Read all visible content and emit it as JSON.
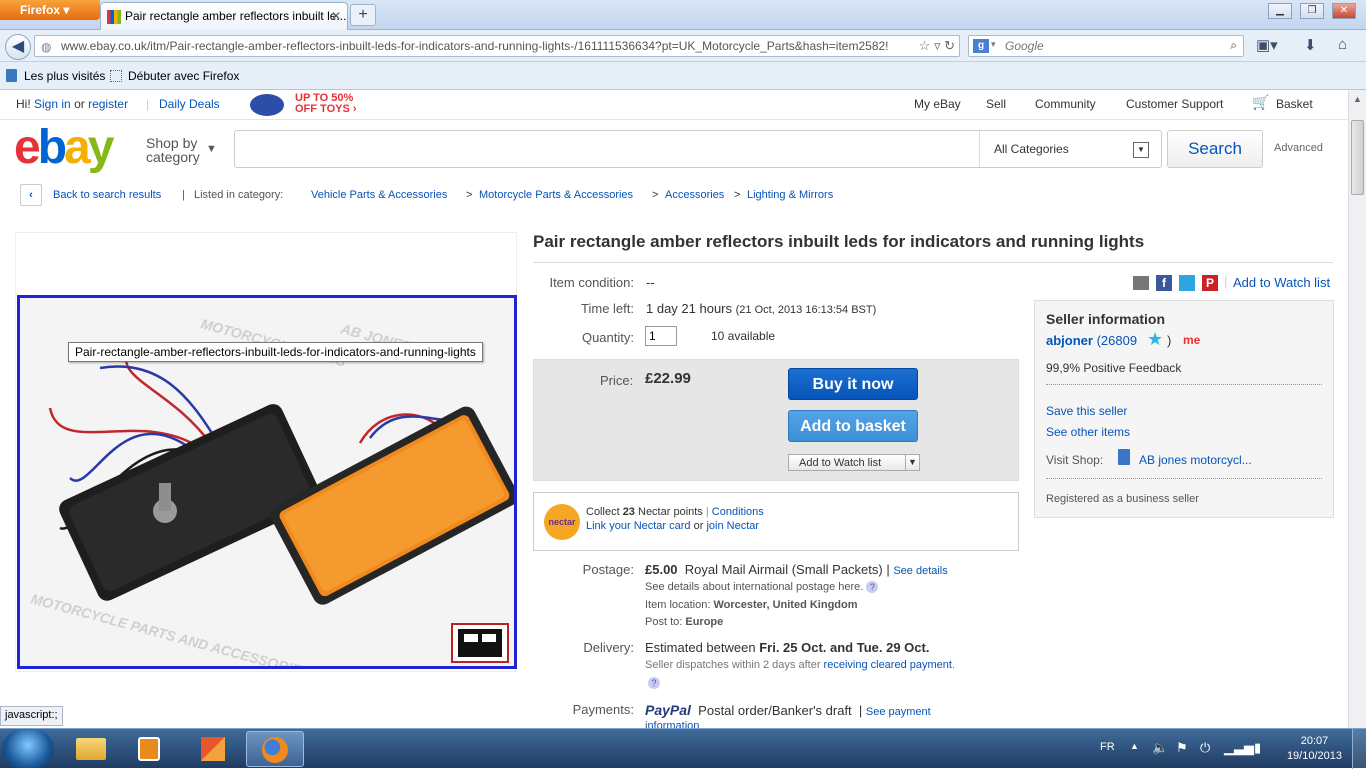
{
  "browser": {
    "menu_label": "Firefox",
    "tab_title": "Pair rectangle amber reflectors inbuilt le...",
    "new_tab": "+",
    "url": "www.ebay.co.uk/itm/Pair-rectangle-amber-reflectors-inbuilt-leds-for-indicators-and-running-lights-/161111536634?pt=UK_Motorcycle_Parts&hash=item2582!",
    "search_engine": "g",
    "search_placeholder": "Google",
    "bookmarks": [
      "Les plus visités",
      "Débuter avec Firefox"
    ],
    "status_text": "javascript:;"
  },
  "ebay": {
    "greeting_prefix": "Hi!",
    "sign_in": "Sign in",
    "or": "or",
    "register": "register",
    "daily_deals": "Daily Deals",
    "promo_line1": "UP TO 50%",
    "promo_line2": "OFF TOYS",
    "top_links": [
      "My eBay",
      "Sell",
      "Community",
      "Customer Support",
      "Basket"
    ],
    "shop_by_1": "Shop by",
    "shop_by_2": "category",
    "category_select": "All Categories",
    "search_button": "Search",
    "advanced": "Advanced",
    "back_to_results": "Back to search results",
    "listed_in": "Listed in category:",
    "breadcrumb": [
      "Vehicle Parts & Accessories",
      "Motorcycle Parts & Accessories",
      "Accessories",
      "Lighting & Mirrors"
    ],
    "image_tooltip": "Pair-rectangle-amber-reflectors-inbuilt-leds-for-indicators-and-running-lights",
    "watermark_1": "MOTORCYCLE PARTS",
    "watermark_2": "AB JONES",
    "watermark_3": "MOTORCYCLE PARTS AND ACCESSORIES"
  },
  "listing": {
    "title": "Pair rectangle amber reflectors inbuilt leds for indicators and running lights",
    "condition_label": "Item condition:",
    "condition_value": "--",
    "time_left_label": "Time left:",
    "time_left_value": "1 day 21 hours",
    "time_left_date": "(21 Oct, 2013  16:13:54 BST)",
    "quantity_label": "Quantity:",
    "quantity_value": "1",
    "available": "10 available",
    "price_label": "Price:",
    "price": "£22.99",
    "buy_now": "Buy it now",
    "add_to_basket": "Add to basket",
    "add_to_watch": "Add to Watch list",
    "add_to_watch_list_link": "Add to Watch list",
    "nectar_collect_prefix": "Collect",
    "nectar_points": "23",
    "nectar_collect_suffix": "Nectar points",
    "nectar_conditions": "Conditions",
    "nectar_link_card": "Link your Nectar card",
    "nectar_or": "or",
    "nectar_join": "join Nectar",
    "nectar_logo": "nectar",
    "postage_label": "Postage:",
    "postage_price": "£5.00",
    "postage_service": "Royal Mail Airmail (Small Packets)",
    "postage_see_details": "See details",
    "postage_intl": "See details about international postage here.",
    "item_location_label": "Item location:",
    "item_location": "Worcester, United Kingdom",
    "post_to_label": "Post to:",
    "post_to": "Europe",
    "delivery_label": "Delivery:",
    "delivery_prefix": "Estimated between",
    "delivery_dates": "Fri. 25 Oct. and Tue. 29 Oct.",
    "dispatch_note": "Seller dispatches within 2 days after",
    "dispatch_link": "receiving cleared payment",
    "payments_label": "Payments:",
    "paypal": "PayPal",
    "payments_other": "Postal order/Banker's draft",
    "see_payment": "See payment",
    "information": "information"
  },
  "seller": {
    "heading": "Seller information",
    "name": "abjoner",
    "feedback_count": "(26809",
    "feedback_close": ")",
    "me_badge": "me",
    "positive": "99,9% Positive Feedback",
    "save_seller": "Save this seller",
    "see_other": "See other items",
    "visit_shop_label": "Visit Shop:",
    "shop_name": "AB jones motorcycl...",
    "registered": "Registered as a business seller"
  },
  "taskbar": {
    "language": "FR",
    "time": "20:07",
    "date": "19/10/2013"
  },
  "colors": {
    "ebay_red": "#e53238",
    "ebay_blue": "#0064d2",
    "ebay_yellow": "#f5af02",
    "ebay_green": "#86b817",
    "link": "#0654ba",
    "buy_button": "#0654ba",
    "basket_button": "#3c8fd6",
    "promo": "#e53238"
  }
}
